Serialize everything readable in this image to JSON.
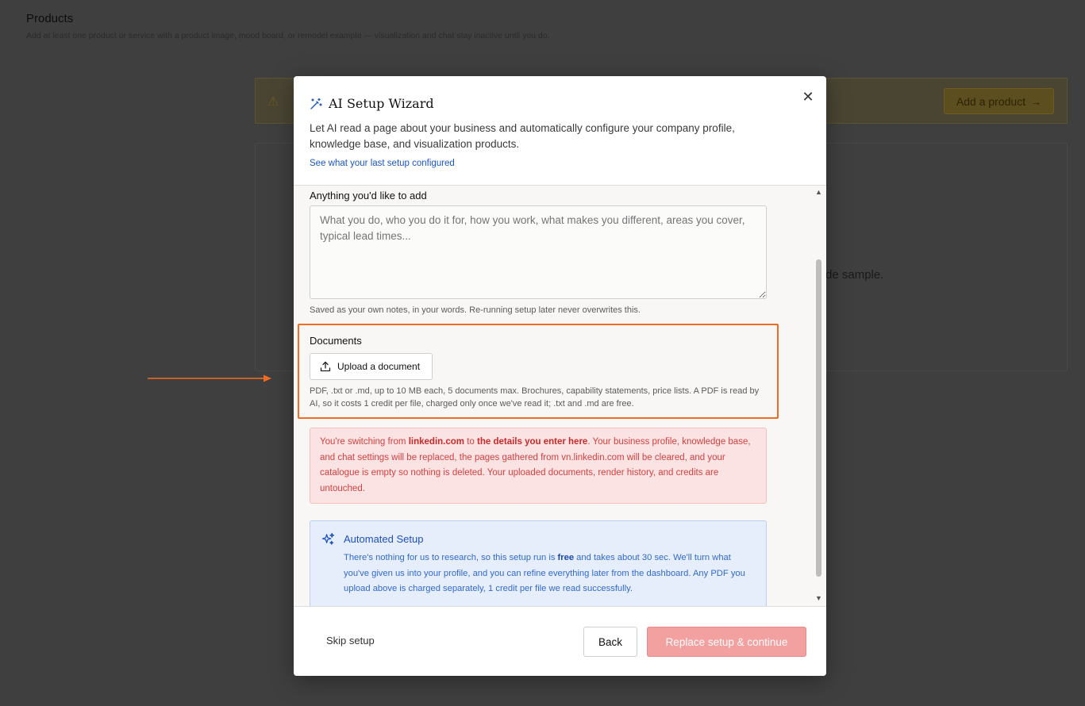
{
  "background": {
    "title": "Products",
    "subtitle": "Add at least one product or service with a product image, mood board, or remodel example — visualization and chat stay inactive until you do.",
    "banner_button": "Add a product",
    "card_text": "de sample."
  },
  "modal": {
    "title": "AI Setup Wizard",
    "description": "Let AI read a page about your business and automatically configure your company profile, knowledge base, and visualization products.",
    "link": "See what your last setup configured",
    "notes": {
      "label": "Anything you'd like to add",
      "placeholder": "What you do, who you do it for, how you work, what makes you different, areas you cover, typical lead times...",
      "hint": "Saved as your own notes, in your words. Re-running setup later never overwrites this."
    },
    "documents": {
      "label": "Documents",
      "upload_button": "Upload a document",
      "hint": "PDF, .txt or .md, up to 10 MB each, 5 documents max. Brochures, capability statements, price lists. A PDF is read by AI, so it costs 1 credit per file, charged only once we've read it; .txt and .md are free."
    },
    "warning": {
      "t1": "You're switching from ",
      "b1": "linkedin.com",
      "t2": " to ",
      "b2": "the details you enter here",
      "t3": ". Your business profile, knowledge base, and chat settings will be replaced, the pages gathered from vn.linkedin.com will be cleared, and your catalogue is empty so nothing is deleted. Your uploaded documents, render history, and credits are untouched."
    },
    "automated": {
      "title": "Automated Setup",
      "t1": "There's nothing for us to research, so this setup run is ",
      "b1": "free",
      "t2": " and takes about 30 sec. We'll turn what you've given us into your profile, and you can refine everything later from the dashboard. Any PDF you upload above is charged separately, 1 credit per file we read successfully."
    },
    "footer": {
      "skip": "Skip setup",
      "back": "Back",
      "primary": "Replace setup & continue"
    }
  },
  "colors": {
    "accent_blue": "#1a56c4",
    "highlight_orange": "#f26b21",
    "warning_red": "#d64040",
    "primary_disabled": "#f3a0a0"
  }
}
